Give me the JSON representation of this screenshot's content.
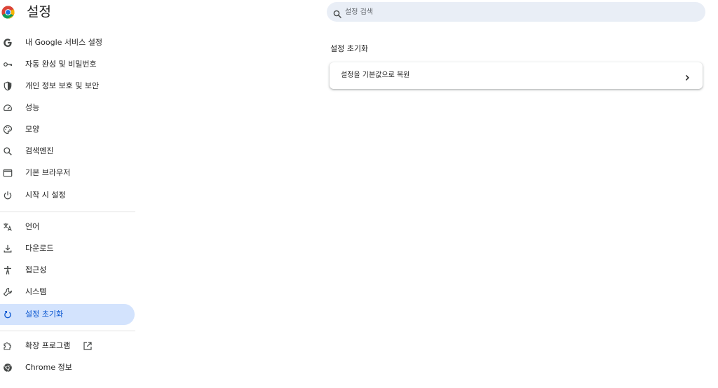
{
  "header": {
    "title": "설정",
    "logo_icon": "chrome-logo-icon"
  },
  "search": {
    "placeholder": "설정 검색",
    "value": "",
    "icon": "search-icon"
  },
  "sidebar": {
    "items": [
      {
        "label": "내 Google 서비스 설정",
        "icon": "google-g-icon"
      },
      {
        "label": "자동 완성 및 비밀번호",
        "icon": "key-icon"
      },
      {
        "label": "개인 정보 보호 및 보안",
        "icon": "shield-icon"
      },
      {
        "label": "성능",
        "icon": "speedometer-icon"
      },
      {
        "label": "모양",
        "icon": "palette-icon"
      },
      {
        "label": "검색엔진",
        "icon": "search-icon"
      },
      {
        "label": "기본 브라우저",
        "icon": "browser-window-icon"
      },
      {
        "label": "시작 시 설정",
        "icon": "power-icon"
      },
      {
        "label": "언어",
        "icon": "translate-icon"
      },
      {
        "label": "다운로드",
        "icon": "download-icon"
      },
      {
        "label": "접근성",
        "icon": "accessibility-icon"
      },
      {
        "label": "시스템",
        "icon": "wrench-icon"
      },
      {
        "label": "설정 초기화",
        "icon": "reset-icon",
        "active": true
      },
      {
        "label": "확장 프로그램",
        "icon": "puzzle-icon",
        "external": true
      },
      {
        "label": "Chrome 정보",
        "icon": "chrome-outline-icon"
      }
    ]
  },
  "main": {
    "section_title": "설정 초기화",
    "reset_row_label": "설정을 기본값으로 복원"
  },
  "colors": {
    "accent": "#0b57d0",
    "active_bg": "#d3e3fd",
    "search_bg": "#e9eef6",
    "icon": "#444746"
  }
}
